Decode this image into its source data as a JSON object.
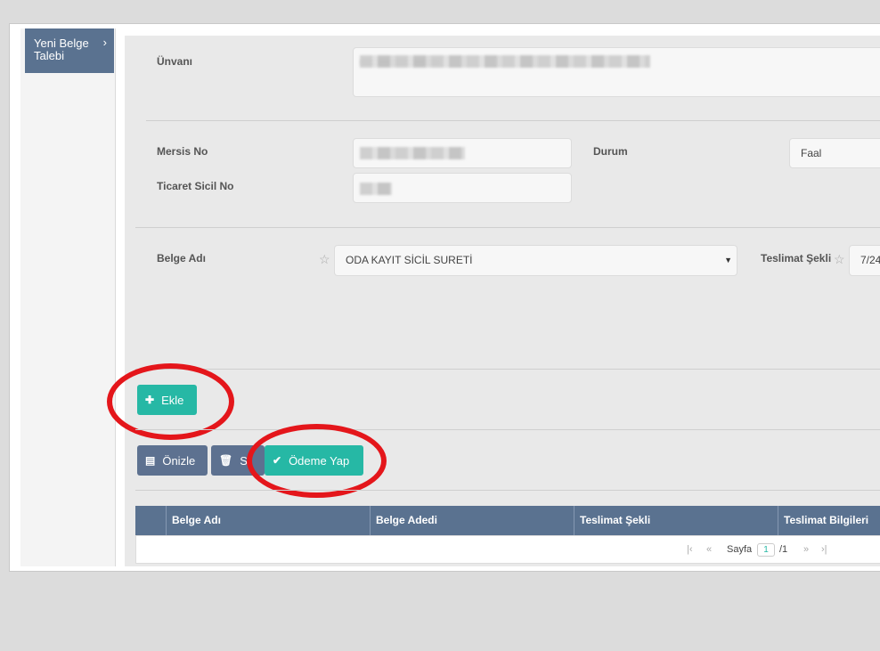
{
  "sidebar": {
    "item_label": "Yeni Belge Talebi",
    "chevron_icon": "chevron-right-icon"
  },
  "form": {
    "unvan_label": "Ünvanı",
    "mersis_label": "Mersis No",
    "ticaret_label": "Ticaret Sicil No",
    "durum_label": "Durum",
    "durum_value": "Faal",
    "belge_adi_label": "Belge Adı",
    "belge_adi_value": "ODA KAYIT SİCİL SURETİ",
    "teslimat_label": "Teslimat Şekli",
    "teslimat_value": "7/24"
  },
  "buttons": {
    "ekle": "Ekle",
    "onizle": "Önizle",
    "sil": "Si",
    "odeme": "Ödeme Yap"
  },
  "table": {
    "columns": [
      "Belge Adı",
      "Belge Adedi",
      "Teslimat Şekli",
      "Teslimat Bilgileri"
    ],
    "pager": {
      "label": "Sayfa",
      "page": "1",
      "total": "/1"
    }
  },
  "colors": {
    "accent_teal": "#26b8a5",
    "header_slate": "#5a7290",
    "highlight_red": "#e4161b"
  }
}
